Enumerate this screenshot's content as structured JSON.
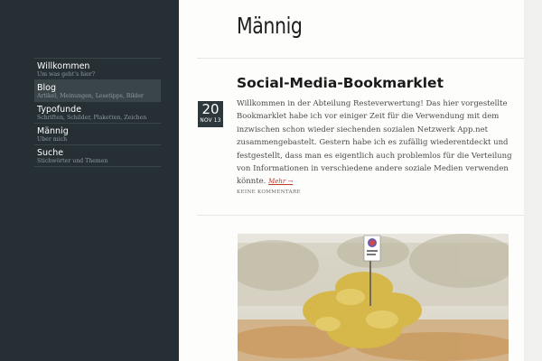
{
  "site": {
    "title": "Männig"
  },
  "nav": {
    "items": [
      {
        "title": "Willkommen",
        "subtitle": "Um was geht's hier?",
        "active": false
      },
      {
        "title": "Blog",
        "subtitle": "Artikel, Meinungen, Lesetipps, Bilder",
        "active": true
      },
      {
        "title": "Typofunde",
        "subtitle": "Schriften, Schilder, Plaketten, Zeichen",
        "active": false
      },
      {
        "title": "Männig",
        "subtitle": "Über mich",
        "active": false
      },
      {
        "title": "Suche",
        "subtitle": "Stichwörter und Themen",
        "active": false
      }
    ]
  },
  "post": {
    "title": "Social-Media-Bookmarklet",
    "date_day": "20",
    "date_month_year": "NOV 13",
    "excerpt": "Willkommen in der Abteilung Resteverwertung! Das hier vorgestellte Bookmarklet habe ich vor einiger Zeit für die Verwendung mit dem inzwischen schon wieder siechenden sozialen Netzwerk App.net zusammengebastelt. Gestern habe ich es zufällig wiederentdeckt und festgestellt, dass man es eigentlich auch problemlos für die Verteilung von Informationen in verschiedene andere soziale Medien verwenden könnte.",
    "more_link": "Mehr →",
    "comments": "KEINE KOMMENTARE"
  },
  "colors": {
    "sidebar_bg": "#262f33",
    "active_item_bg": "#3a4549",
    "date_badge_bg": "#2d383c",
    "link_accent": "#c0392b"
  }
}
